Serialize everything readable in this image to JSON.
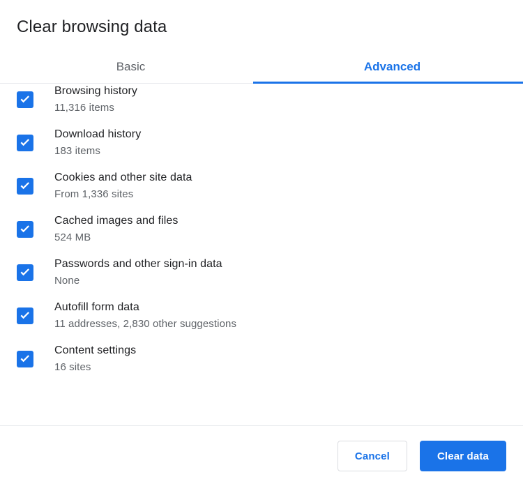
{
  "dialog": {
    "title": "Clear browsing data"
  },
  "tabs": [
    {
      "label": "Basic",
      "selected": false
    },
    {
      "label": "Advanced",
      "selected": true
    }
  ],
  "items": [
    {
      "label": "Browsing history",
      "sub": "11,316 items",
      "checked": true
    },
    {
      "label": "Download history",
      "sub": "183 items",
      "checked": true
    },
    {
      "label": "Cookies and other site data",
      "sub": "From 1,336 sites",
      "checked": true
    },
    {
      "label": "Cached images and files",
      "sub": "524 MB",
      "checked": true
    },
    {
      "label": "Passwords and other sign-in data",
      "sub": "None",
      "checked": true
    },
    {
      "label": "Autofill form data",
      "sub": "11 addresses, 2,830 other suggestions",
      "checked": true
    },
    {
      "label": "Content settings",
      "sub": "16 sites",
      "checked": true
    }
  ],
  "footer": {
    "cancel_label": "Cancel",
    "confirm_label": "Clear data"
  },
  "colors": {
    "accent": "#1a73e8",
    "text_primary": "#202124",
    "text_secondary": "#5f6368",
    "divider": "#e8eaed",
    "button_border": "#dadce0"
  }
}
